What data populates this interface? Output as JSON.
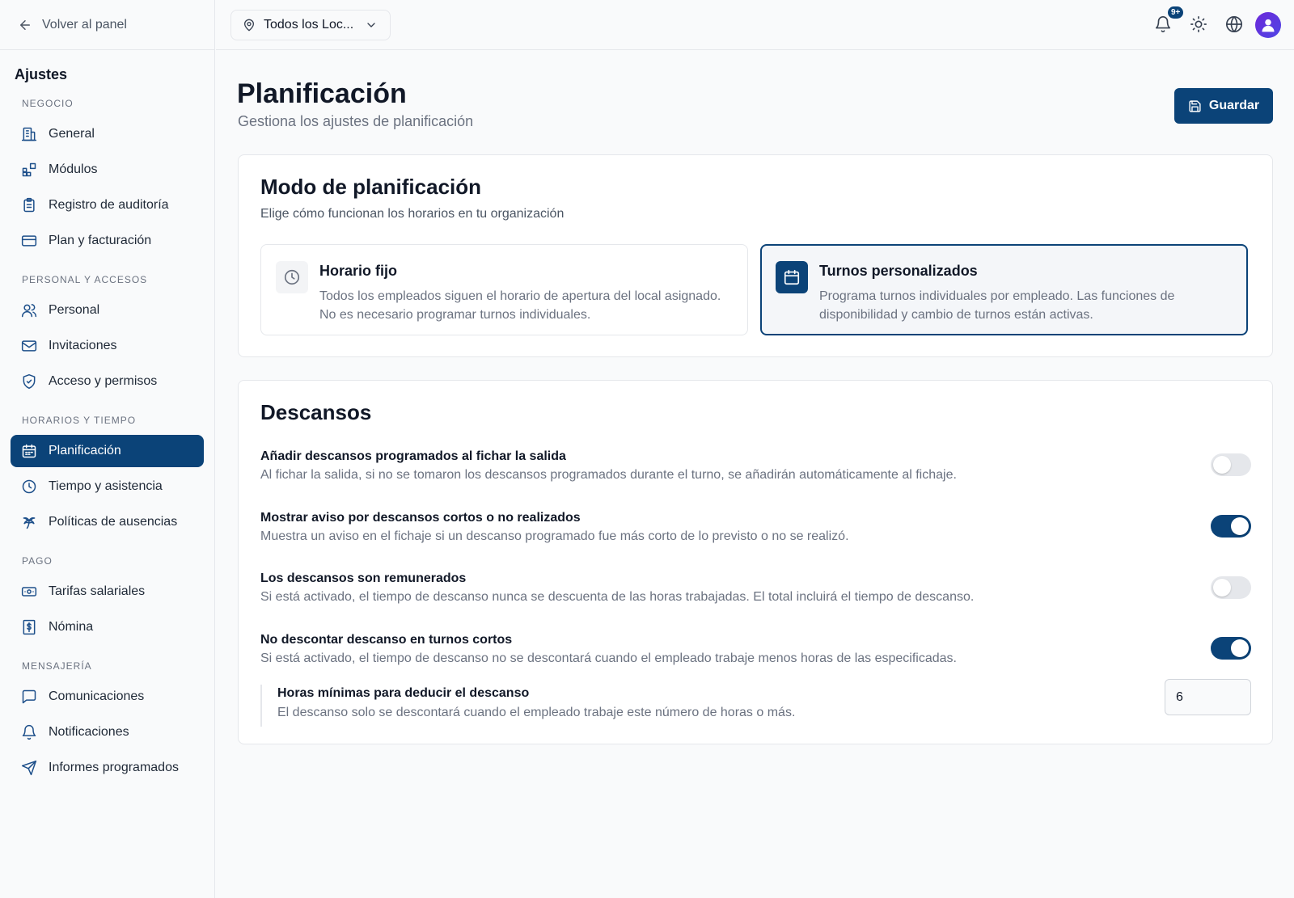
{
  "back_label": "Volver al panel",
  "sidebar": {
    "title": "Ajustes",
    "sections": [
      {
        "label": "NEGOCIO",
        "items": [
          "General",
          "Módulos",
          "Registro de auditoría",
          "Plan y facturación"
        ]
      },
      {
        "label": "PERSONAL Y ACCESOS",
        "items": [
          "Personal",
          "Invitaciones",
          "Acceso y permisos"
        ]
      },
      {
        "label": "HORARIOS Y TIEMPO",
        "items": [
          "Planificación",
          "Tiempo y asistencia",
          "Políticas de ausencias"
        ]
      },
      {
        "label": "PAGO",
        "items": [
          "Tarifas salariales",
          "Nómina"
        ]
      },
      {
        "label": "MENSAJERÍA",
        "items": [
          "Comunicaciones",
          "Notificaciones",
          "Informes programados"
        ]
      }
    ],
    "active_item": "Planificación"
  },
  "topbar": {
    "location_label": "Todos los Loc...",
    "notification_badge": "9+"
  },
  "page": {
    "title": "Planificación",
    "subtitle": "Gestiona los ajustes de planificación",
    "save_label": "Guardar"
  },
  "mode_card": {
    "title": "Modo de planificación",
    "subtitle": "Elige cómo funcionan los horarios en tu organización",
    "options": [
      {
        "title": "Horario fijo",
        "description": "Todos los empleados siguen el horario de apertura del local asignado. No es necesario programar turnos individuales.",
        "selected": false
      },
      {
        "title": "Turnos personalizados",
        "description": "Programa turnos individuales por empleado. Las funciones de disponibilidad y cambio de turnos están activas.",
        "selected": true
      }
    ]
  },
  "breaks_card": {
    "title": "Descansos",
    "settings": [
      {
        "title": "Añadir descansos programados al fichar la salida",
        "description": "Al fichar la salida, si no se tomaron los descansos programados durante el turno, se añadirán automáticamente al fichaje.",
        "enabled": false
      },
      {
        "title": "Mostrar aviso por descansos cortos o no realizados",
        "description": "Muestra un aviso en el fichaje si un descanso programado fue más corto de lo previsto o no se realizó.",
        "enabled": true
      },
      {
        "title": "Los descansos son remunerados",
        "description": "Si está activado, el tiempo de descanso nunca se descuenta de las horas trabajadas. El total incluirá el tiempo de descanso.",
        "enabled": false
      },
      {
        "title": "No descontar descanso en turnos cortos",
        "description": "Si está activado, el tiempo de descanso no se descontará cuando el empleado trabaje menos horas de las especificadas.",
        "enabled": true
      }
    ],
    "min_hours": {
      "title": "Horas mínimas para deducir el descanso",
      "description": "El descanso solo se descontará cuando el empleado trabaje este número de horas o más.",
      "value": "6"
    }
  },
  "colors": {
    "accent": "#0b4378",
    "icon": "#1d4f8a"
  }
}
